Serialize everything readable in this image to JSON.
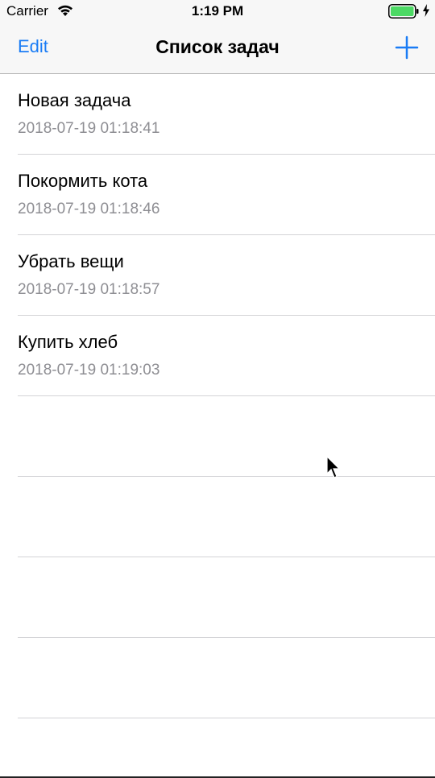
{
  "status_bar": {
    "carrier": "Carrier",
    "time": "1:19 PM",
    "icons": [
      "wifi-icon",
      "battery-icon",
      "charging-icon"
    ],
    "battery_color": "#4cd964"
  },
  "nav": {
    "edit_label": "Edit",
    "title": "Список задач",
    "add_icon": "plus-icon",
    "accent_color": "#1a7cf5"
  },
  "tasks": [
    {
      "title": "Новая задача",
      "date": "2018-07-19 01:18:41"
    },
    {
      "title": "Покормить кота",
      "date": "2018-07-19 01:18:46"
    },
    {
      "title": "Убрать вещи",
      "date": "2018-07-19 01:18:57"
    },
    {
      "title": "Купить хлеб",
      "date": "2018-07-19 01:19:03"
    }
  ]
}
